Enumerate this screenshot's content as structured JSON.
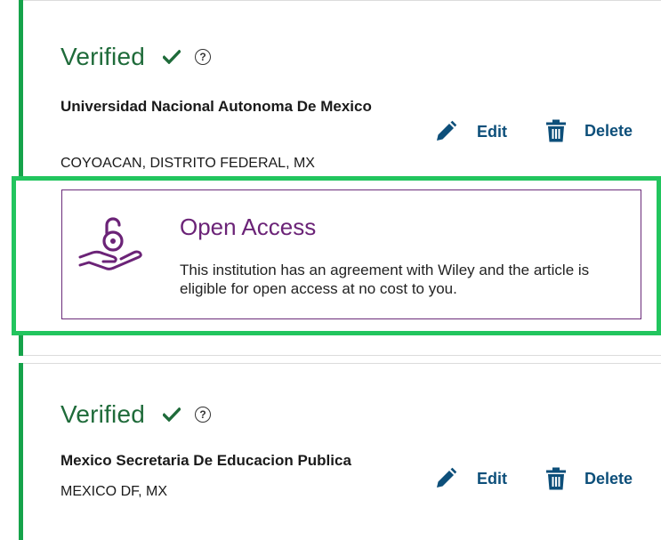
{
  "affiliations": [
    {
      "status": "Verified",
      "name": "Universidad Nacional Autonoma De Mexico",
      "location": "COYOACAN, DISTRITO FEDERAL, MX",
      "edit_label": "Edit",
      "delete_label": "Delete",
      "open_access": {
        "title": "Open Access",
        "description": "This institution has an agreement with Wiley and the article is eligible for open access at no cost to you."
      }
    },
    {
      "status": "Verified",
      "name": "Mexico Secretaria De Educacion Publica",
      "location": "MEXICO DF, MX",
      "edit_label": "Edit",
      "delete_label": "Delete"
    }
  ],
  "help_glyph": "?",
  "colors": {
    "accent_green": "#16a34a",
    "verified_green": "#1f6b3a",
    "highlight_green": "#22c55e",
    "action_blue": "#0d4f7a",
    "open_access_purple": "#6b2377"
  },
  "icons": {
    "verified": "check-icon",
    "help": "help-circle-icon",
    "edit": "pencil-icon",
    "delete": "trash-icon",
    "open_access": "open-lock-hand-icon"
  }
}
